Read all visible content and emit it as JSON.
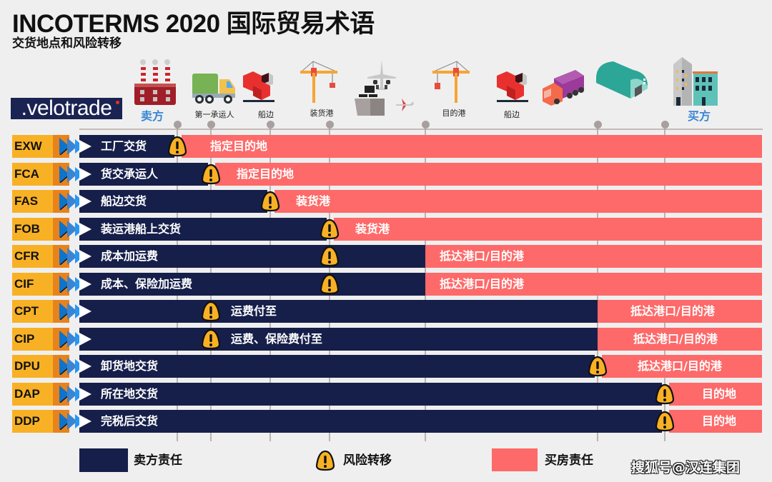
{
  "header": {
    "title": "INCOTERMS 2020 国际贸易术语",
    "subtitle": "交货地点和风险转移"
  },
  "logo": {
    "text": ".velotrade"
  },
  "stages": [
    {
      "icon": "factory-icon",
      "label": "卖方",
      "party": true
    },
    {
      "icon": "truck-icon",
      "label": "第一承运人"
    },
    {
      "icon": "cargo-boxes-icon",
      "label": "船边"
    },
    {
      "icon": "crane-icon",
      "label": "装货港"
    },
    {
      "icon": "ship-plane-icon",
      "label": ""
    },
    {
      "icon": "crane-icon",
      "label": "目的港"
    },
    {
      "icon": "cargo-boxes-icon",
      "label": "船边"
    },
    {
      "icon": "truck-icon",
      "label": ""
    },
    {
      "icon": "warehouse-icon",
      "label": ""
    },
    {
      "icon": "buildings-icon",
      "label": "买方",
      "party": true
    }
  ],
  "terms": [
    {
      "code": "EXW",
      "seller_label": "工厂交货",
      "buyer_label": "指定目的地",
      "seller_until": "工厂",
      "risk_at": "工厂"
    },
    {
      "code": "FCA",
      "seller_label": "货交承运人",
      "buyer_label": "指定目的地",
      "seller_until": "第一承运人",
      "risk_at": "第一承运人"
    },
    {
      "code": "FAS",
      "seller_label": "船边交货",
      "buyer_label": "装货港",
      "seller_until": "船边",
      "risk_at": "船边"
    },
    {
      "code": "FOB",
      "seller_label": "装运港船上交货",
      "buyer_label": "装货港",
      "seller_until": "装货港",
      "risk_at": "装货港"
    },
    {
      "code": "CFR",
      "seller_label": "成本加运费",
      "buyer_label": "抵达港口/目的港",
      "seller_until": "目的港",
      "risk_at": "装货港"
    },
    {
      "code": "CIF",
      "seller_label": "成本、保险加运费",
      "buyer_label": "抵达港口/目的港",
      "seller_until": "目的港",
      "risk_at": "装货港"
    },
    {
      "code": "CPT",
      "seller_label": "运费付至",
      "buyer_label": "抵达港口/目的港",
      "seller_until": "仓库",
      "risk_at": "第一承运人"
    },
    {
      "code": "CIP",
      "seller_label": "运费、保险费付至",
      "buyer_label": "抵达港口/目的港",
      "seller_until": "仓库",
      "risk_at": "第一承运人"
    },
    {
      "code": "DPU",
      "seller_label": "卸货地交货",
      "buyer_label": "抵达港口/目的港",
      "seller_until": "仓库",
      "risk_at": "仓库"
    },
    {
      "code": "DAP",
      "seller_label": "所在地交货",
      "buyer_label": "目的地",
      "seller_until": "买方",
      "risk_at": "买方"
    },
    {
      "code": "DDP",
      "seller_label": "完税后交货",
      "buyer_label": "目的地",
      "seller_until": "买方",
      "risk_at": "买方"
    }
  ],
  "legend": {
    "seller": "卖方责任",
    "risk": "风险转移",
    "buyer": "买房责任"
  },
  "colors": {
    "seller": "#161f4a",
    "buyer": "#fe6969",
    "warning": "#f8b125",
    "code_bg": "#f8b125"
  },
  "watermark": "搜狐号@汉连集团"
}
